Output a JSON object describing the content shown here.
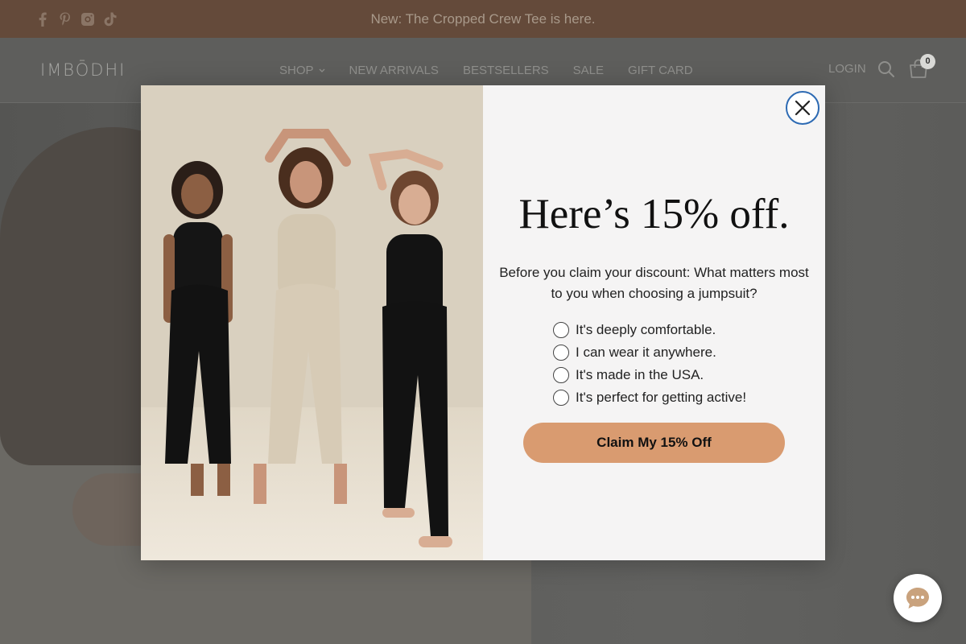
{
  "announcement": {
    "text": "New: The Cropped Crew Tee is here.",
    "social_icons": [
      "facebook-icon",
      "pinterest-icon",
      "instagram-icon",
      "tiktok-icon"
    ]
  },
  "header": {
    "logo": "IMBŌDHI",
    "nav": [
      "SHOP",
      "NEW ARRIVALS",
      "BESTSELLERS",
      "SALE",
      "GIFT CARD"
    ],
    "login": "LOGIN",
    "cart_count": "0"
  },
  "popup": {
    "headline": "Here’s 15% off.",
    "question": "Before you claim your discount: What matters most to you when choosing a jumpsuit?",
    "options": [
      "It's deeply comfortable.",
      "I can wear it anywhere.",
      "It's made in the USA.",
      "It's perfect for getting active!"
    ],
    "cta": "Claim My 15% Off"
  },
  "colors": {
    "announcement_bg": "#644a3a",
    "cta_bg": "#d99b70",
    "close_ring": "#2d6ab3"
  }
}
